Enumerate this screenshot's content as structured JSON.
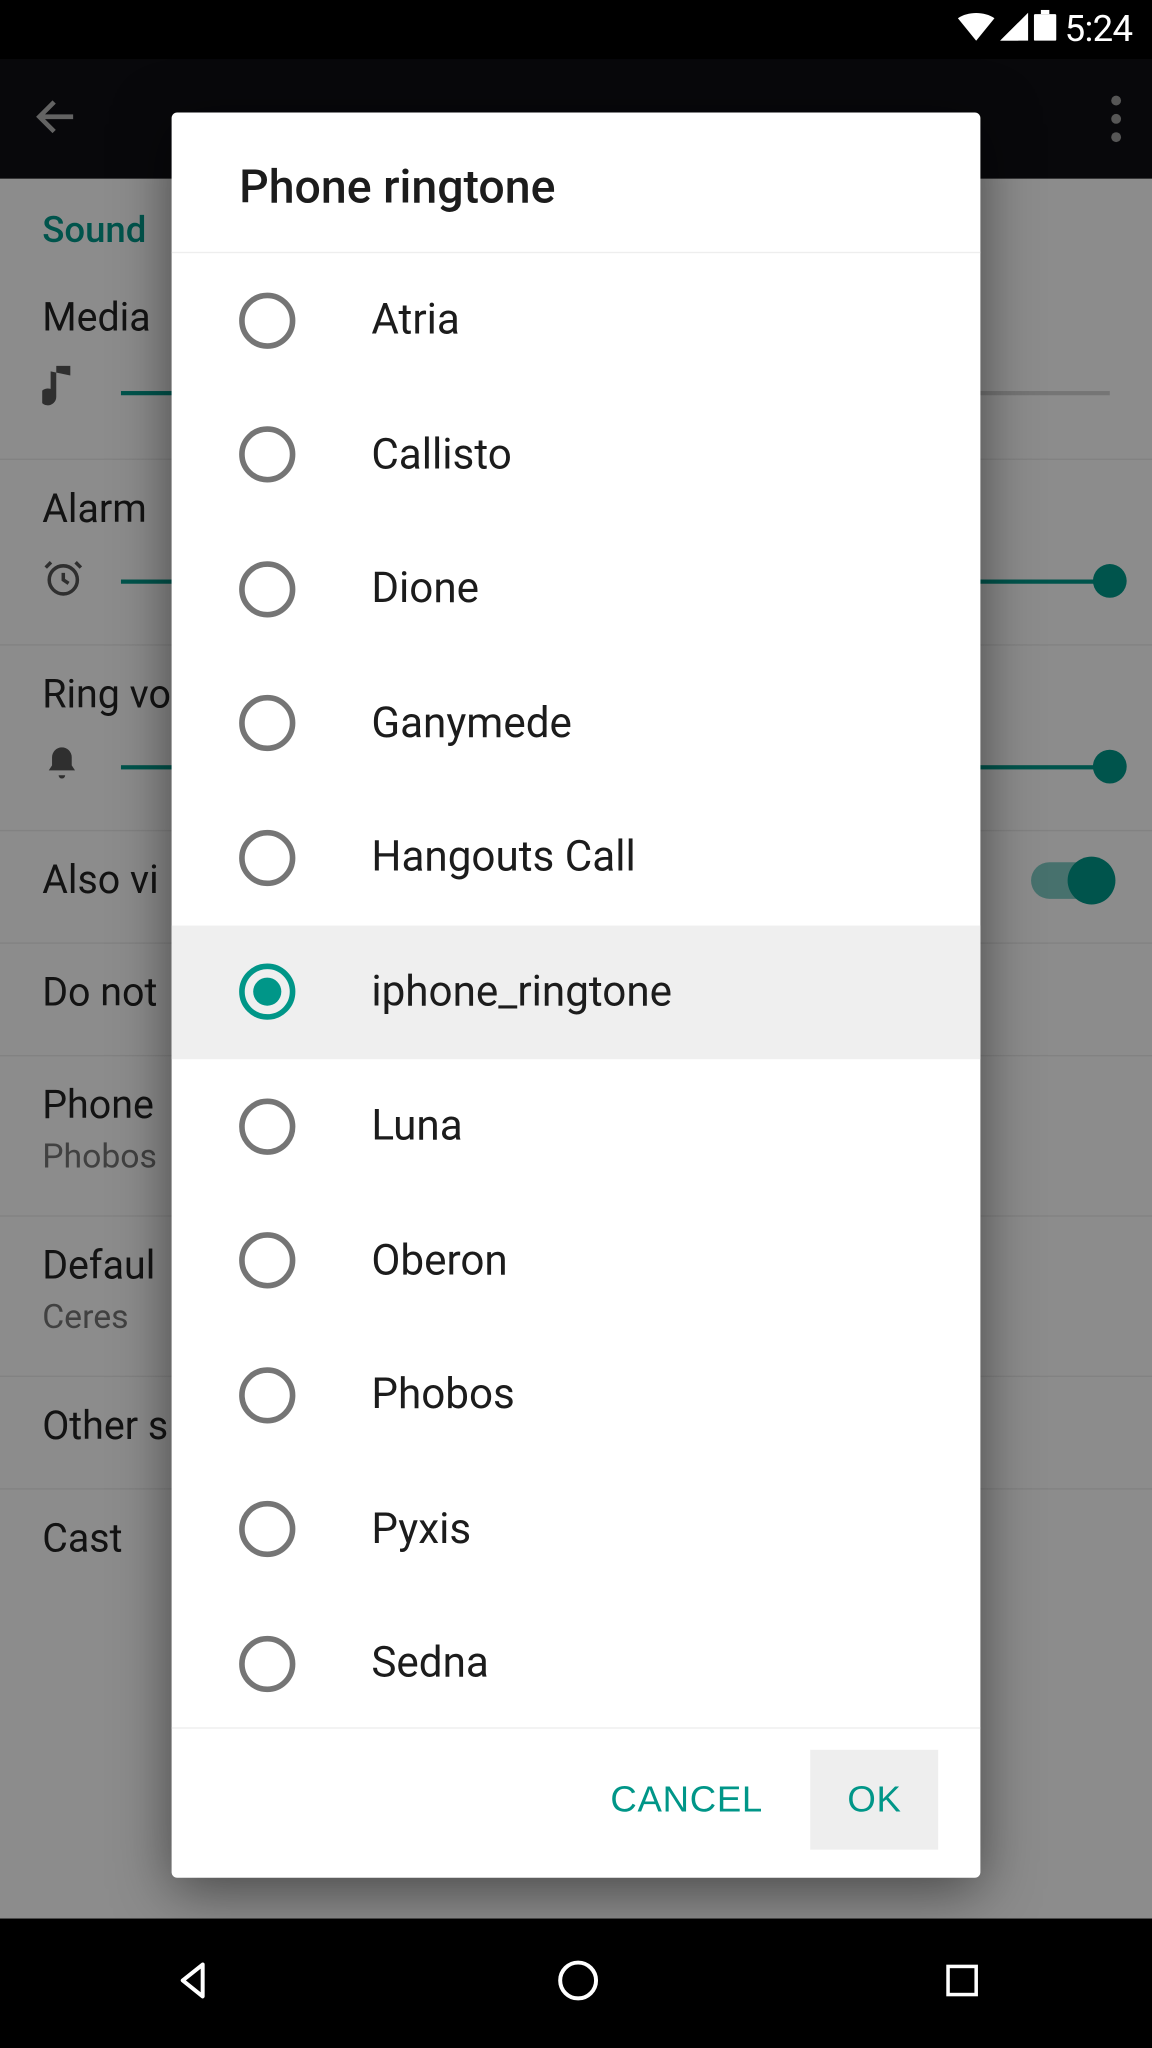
{
  "status_bar": {
    "time": "5:24"
  },
  "dialog": {
    "title": "Phone ringtone",
    "options": [
      "Atria",
      "Callisto",
      "Dione",
      "Ganymede",
      "Hangouts Call",
      "iphone_ringtone",
      "Luna",
      "Oberon",
      "Phobos",
      "Pyxis",
      "Sedna"
    ],
    "selected": "iphone_ringtone",
    "cancel_label": "CANCEL",
    "ok_label": "OK"
  },
  "background": {
    "section_header": "Sound",
    "media_label": "Media",
    "alarm_label": "Alarm",
    "ring_label": "Ring vo",
    "also_vibrate_label": "Also vi",
    "dnd_label": "Do not",
    "phone_ringtone_label": "Phone",
    "phone_ringtone_value": "Phobos",
    "default_notification_label": "Defaul",
    "default_notification_value": "Ceres",
    "other_sounds_label": "Other s",
    "cast_label": "Cast"
  }
}
